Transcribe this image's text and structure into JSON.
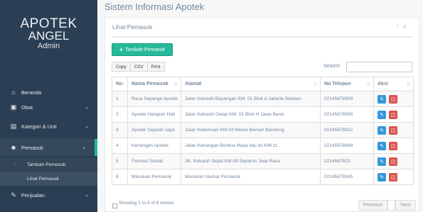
{
  "brand": {
    "line1": "APOTEK",
    "line2": "ANGEL",
    "role": "Admin"
  },
  "sidebar": {
    "items": [
      {
        "label": "Beranda",
        "icon": "home-icon",
        "has_chevron": false
      },
      {
        "label": "Obat",
        "icon": "medkit-icon",
        "has_chevron": true
      },
      {
        "label": "Kategori & Unit",
        "icon": "building-icon",
        "has_chevron": true
      },
      {
        "label": "Pemasok",
        "icon": "users-icon",
        "has_chevron": true
      },
      {
        "label": "Penjualan",
        "icon": "edit-icon",
        "has_chevron": true
      }
    ],
    "submenu": [
      "Tambah Pemasok",
      "Lihat Pemasok"
    ],
    "active_sub": "Lihat Pemasok",
    "accent": "#1abb9c"
  },
  "page": {
    "title": "Sistem Informasi Apotek"
  },
  "panel": {
    "title": "Lihat Pemasok",
    "add_button": "Tambah Pemasok",
    "export_buttons": [
      "Copy",
      "CSV",
      "Print"
    ],
    "search_label": "Search:",
    "search_value": ""
  },
  "table": {
    "headers": [
      "No",
      "Nama Pemasok",
      "Alamat",
      "No Telepon",
      "Aksi"
    ],
    "rows": [
      [
        "1",
        "Rasa Sayange Apotek",
        "Jalan Kekasih Bayangan KM. 01 Blok A Jakarta Selatan",
        "02145678908"
      ],
      [
        "2",
        "Apotek Harapan Hati",
        "Jalan Kekasih Gelap KM. 01 Blok H Jawa Barat",
        "02145678900"
      ],
      [
        "3",
        "Apotek Sejarah Jaya",
        "Jalan Ketemuan KM.03 Mekar Berseri Bandung",
        "02145678912"
      ],
      [
        "4",
        "Kenangan Apotek",
        "Jalan Kenangan Berdua Masa lalu Itu KM.11",
        "02145678989"
      ],
      [
        "5",
        "Farmasi Sehati",
        "Jln. Kekasih Sejati KM.99 Separuh Jiwa Rasa",
        "0214567823"
      ],
      [
        "6",
        "Masukan Pemasok",
        "Masukan Alamat Pemasok",
        "02145678345"
      ]
    ]
  },
  "footer": {
    "info": "Showing 1 to 6 of 6 entries",
    "prev": "Previous",
    "page": "1",
    "next": "Next"
  },
  "colors": {
    "sidebar": "#2a3f54",
    "add_button": "#26b99a",
    "edit": "#3498db",
    "delete": "#d9534f"
  }
}
